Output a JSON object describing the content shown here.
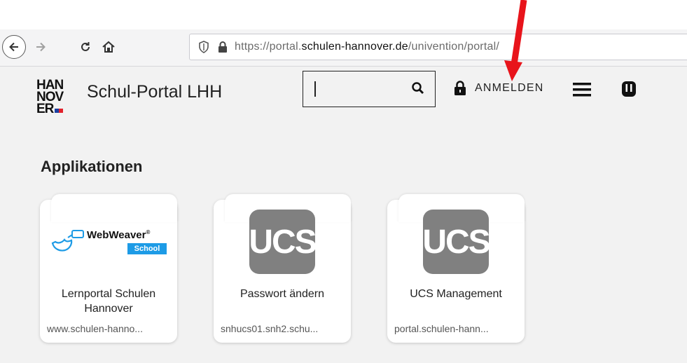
{
  "browser": {
    "url_prefix": "https://portal.",
    "url_domain": "schulen-hannover.de",
    "url_path": "/univention/portal/"
  },
  "header": {
    "title": "Schul-Portal LHH",
    "login_label": "ANMELDEN",
    "logo_text_1": "HAN",
    "logo_text_2": "NOV",
    "logo_text_3": "ER"
  },
  "section": {
    "title": "Applikationen"
  },
  "apps": [
    {
      "title": "Lernportal Schulen Hannover",
      "url": "www.schulen-hanno...",
      "logo": "webweaver",
      "logo_name": "WebWeaver",
      "logo_tag": "School"
    },
    {
      "title": "Passwort ändern",
      "url": "snhucs01.snh2.schu...",
      "logo": "ucs",
      "logo_text": "UCS"
    },
    {
      "title": "UCS Management",
      "url": "portal.schulen-hann...",
      "logo": "ucs",
      "logo_text": "UCS"
    }
  ],
  "colors": {
    "arrow": "#e8141b",
    "ucs_logo": "#808080",
    "webweaver_blue": "#1d9be6"
  }
}
